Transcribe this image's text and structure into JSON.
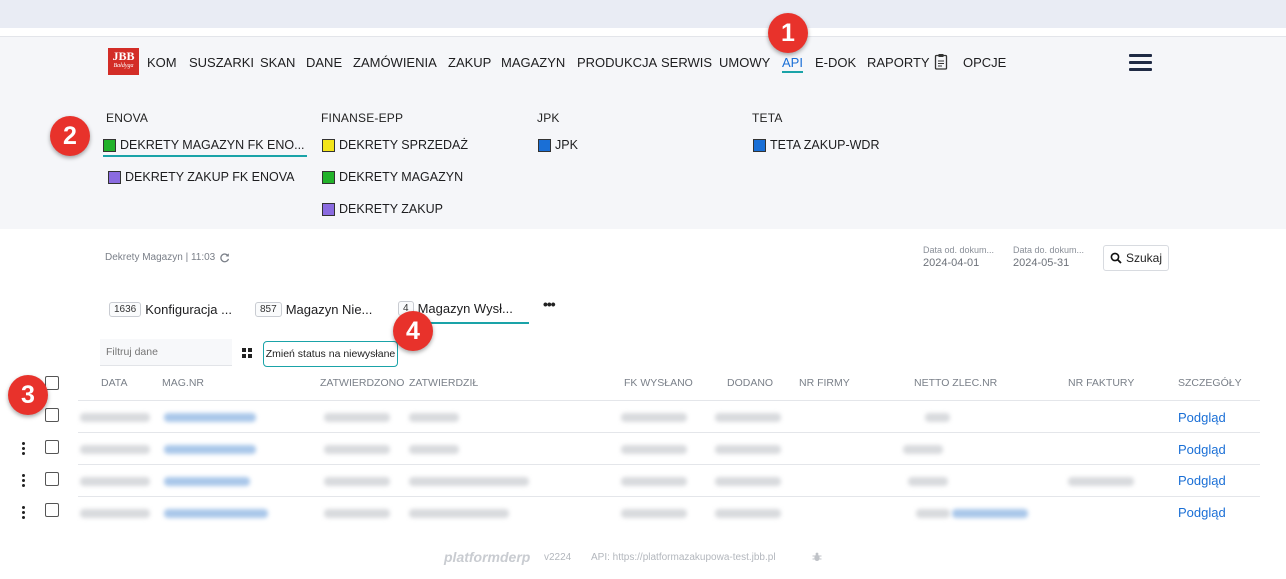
{
  "app": {
    "logo_top": "JBB",
    "logo_bottom": "Bałdyga"
  },
  "nav": {
    "items": [
      "KOM",
      "SUSZARKI",
      "SKAN",
      "DANE",
      "ZAMÓWIENIA",
      "ZAKUP",
      "MAGAZYN",
      "PRODUKCJA",
      "SERWIS",
      "UMOWY",
      "API",
      "E-DOK",
      "RAPORTY",
      "OPCJE"
    ],
    "active": "API"
  },
  "submenu": {
    "groups": [
      {
        "title": "ENOVA",
        "items": [
          {
            "label": "DEKRETY MAGAZYN FK ENO...",
            "color": "#22b22a"
          },
          {
            "label": "DEKRETY ZAKUP FK ENOVA",
            "color": "#8a6be0"
          }
        ]
      },
      {
        "title": "FINANSE-EPP",
        "items": [
          {
            "label": "DEKRETY SPRZEDAŻ",
            "color": "#f3e51a"
          },
          {
            "label": "DEKRETY MAGAZYN",
            "color": "#22b22a"
          },
          {
            "label": "DEKRETY ZAKUP",
            "color": "#8a6be0"
          }
        ]
      },
      {
        "title": "JPK",
        "items": [
          {
            "label": "JPK",
            "color": "#1a6fd6"
          }
        ]
      },
      {
        "title": "TETA",
        "items": [
          {
            "label": "TETA ZAKUP-WDR",
            "color": "#1a6fd6"
          }
        ]
      }
    ]
  },
  "markers": [
    "1",
    "2",
    "3",
    "4"
  ],
  "page": {
    "breadcrumb": "Dekrety Magazyn | 11:03",
    "date_from_label": "Data od. dokum...",
    "date_from": "2024-04-01",
    "date_to_label": "Data do. dokum...",
    "date_to": "2024-05-31",
    "search_label": "Szukaj"
  },
  "tabs": [
    {
      "count": "1636",
      "label": "Konfiguracja ..."
    },
    {
      "count": "857",
      "label": "Magazyn Nie..."
    },
    {
      "count": "4",
      "label": "Magazyn Wysł..."
    }
  ],
  "tabs_more": "•••",
  "toolbar": {
    "filter_placeholder": "Filtruj dane",
    "status_button": "Zmień status na niewysłane"
  },
  "table": {
    "columns": [
      "DATA",
      "MAG.NR",
      "ZATWIERDZONO",
      "ZATWIERDZIŁ",
      "FK WYSŁANO",
      "DODANO",
      "NR FIRMY",
      "NETTO ZLEC.NR",
      "NR FAKTURY",
      "SZCZEGÓŁY"
    ],
    "rows": [
      {
        "details": "Podgląd"
      },
      {
        "details": "Podgląd"
      },
      {
        "details": "Podgląd"
      },
      {
        "details": "Podgląd"
      }
    ]
  },
  "footer": {
    "brand": "platformderp",
    "version": "v2224",
    "api": "API: https://platformazakupowa-test.jbb.pl"
  }
}
